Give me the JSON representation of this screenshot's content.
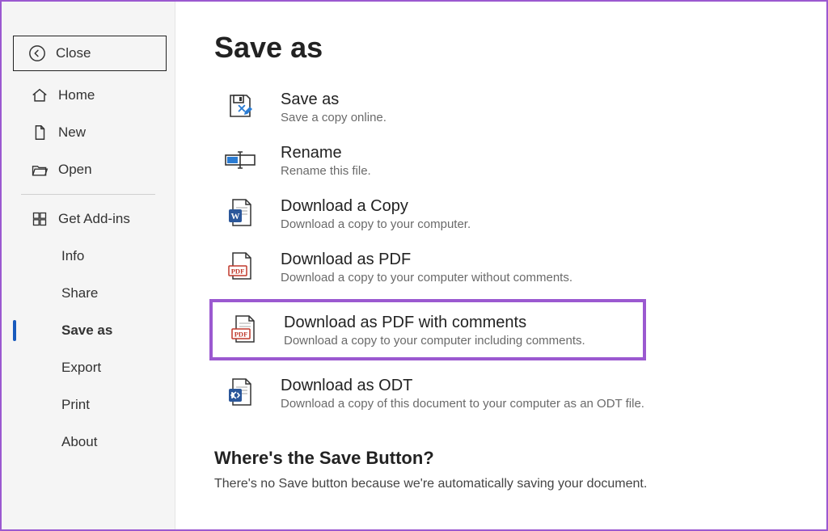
{
  "sidebar": {
    "close": "Close",
    "home": "Home",
    "new": "New",
    "open": "Open",
    "addins": "Get Add-ins",
    "info": "Info",
    "share": "Share",
    "saveas": "Save as",
    "export": "Export",
    "print": "Print",
    "about": "About"
  },
  "page": {
    "title": "Save as"
  },
  "options": {
    "saveas": {
      "title": "Save as",
      "sub": "Save a copy online."
    },
    "rename": {
      "title": "Rename",
      "sub": "Rename this file."
    },
    "download": {
      "title": "Download a Copy",
      "sub": "Download a copy to your computer."
    },
    "pdf": {
      "title": "Download as PDF",
      "sub": "Download a copy to your computer without comments."
    },
    "pdfc": {
      "title": "Download as PDF with comments",
      "sub": "Download a copy to your computer including comments."
    },
    "odt": {
      "title": "Download as ODT",
      "sub": "Download a copy of this document to your computer as an ODT file."
    }
  },
  "footer": {
    "title": "Where's the Save Button?",
    "text": "There's no Save button because we're automatically saving your document."
  }
}
